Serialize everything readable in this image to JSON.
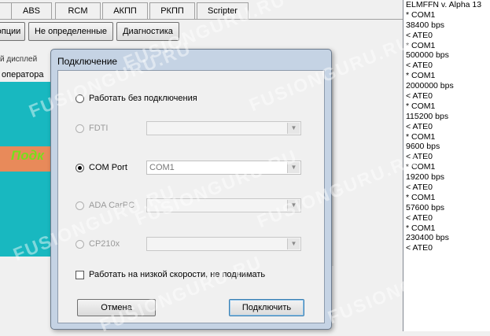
{
  "tabs": [
    "ABS",
    "RCM",
    "АКПП",
    "РКПП",
    "Scripter"
  ],
  "toolbar": {
    "options_partial": "опции",
    "undefined_btn": "Не определенные",
    "diagnostics_btn": "Диагностика"
  },
  "background": {
    "partial_text": "й дисплей",
    "operator_partial": "оператора",
    "banner_partial": "Подк"
  },
  "dialog": {
    "title": "Подключение",
    "options": [
      {
        "label": "Работать без подключения",
        "selected": false,
        "enabled": true
      },
      {
        "label": "FDTI",
        "selected": false,
        "enabled": false,
        "combo": ""
      },
      {
        "label": "COM Port",
        "selected": true,
        "enabled": true,
        "combo": "COM1"
      },
      {
        "label": "ADA CarPC",
        "selected": false,
        "enabled": false,
        "combo": ""
      },
      {
        "label": "CP210x",
        "selected": false,
        "enabled": false,
        "combo": ""
      }
    ],
    "low_speed_label": "Работать на низкой скорости, не поднимать",
    "low_speed_checked": false,
    "cancel_btn": "Отмена",
    "connect_btn": "Подключить"
  },
  "log": [
    "ELMFFN v. Alpha 13",
    "* COM1",
    "38400 bps",
    "< ATE0",
    "* COM1",
    "500000 bps",
    "< ATE0",
    "* COM1",
    "2000000 bps",
    "< ATE0",
    "* COM1",
    "115200 bps",
    "< ATE0",
    "* COM1",
    "9600 bps",
    "< ATE0",
    "* COM1",
    "19200 bps",
    "< ATE0",
    "* COM1",
    "57600 bps",
    "< ATE0",
    "* COM1",
    "230400 bps",
    "< ATE0"
  ],
  "watermark": "FUSIONGURU.RU",
  "colors": {
    "teal_panel": "#18b8c0",
    "orange_banner": "#e88a5a",
    "banner_text": "#76e01a",
    "dialog_frame": "#c5d3e4"
  }
}
